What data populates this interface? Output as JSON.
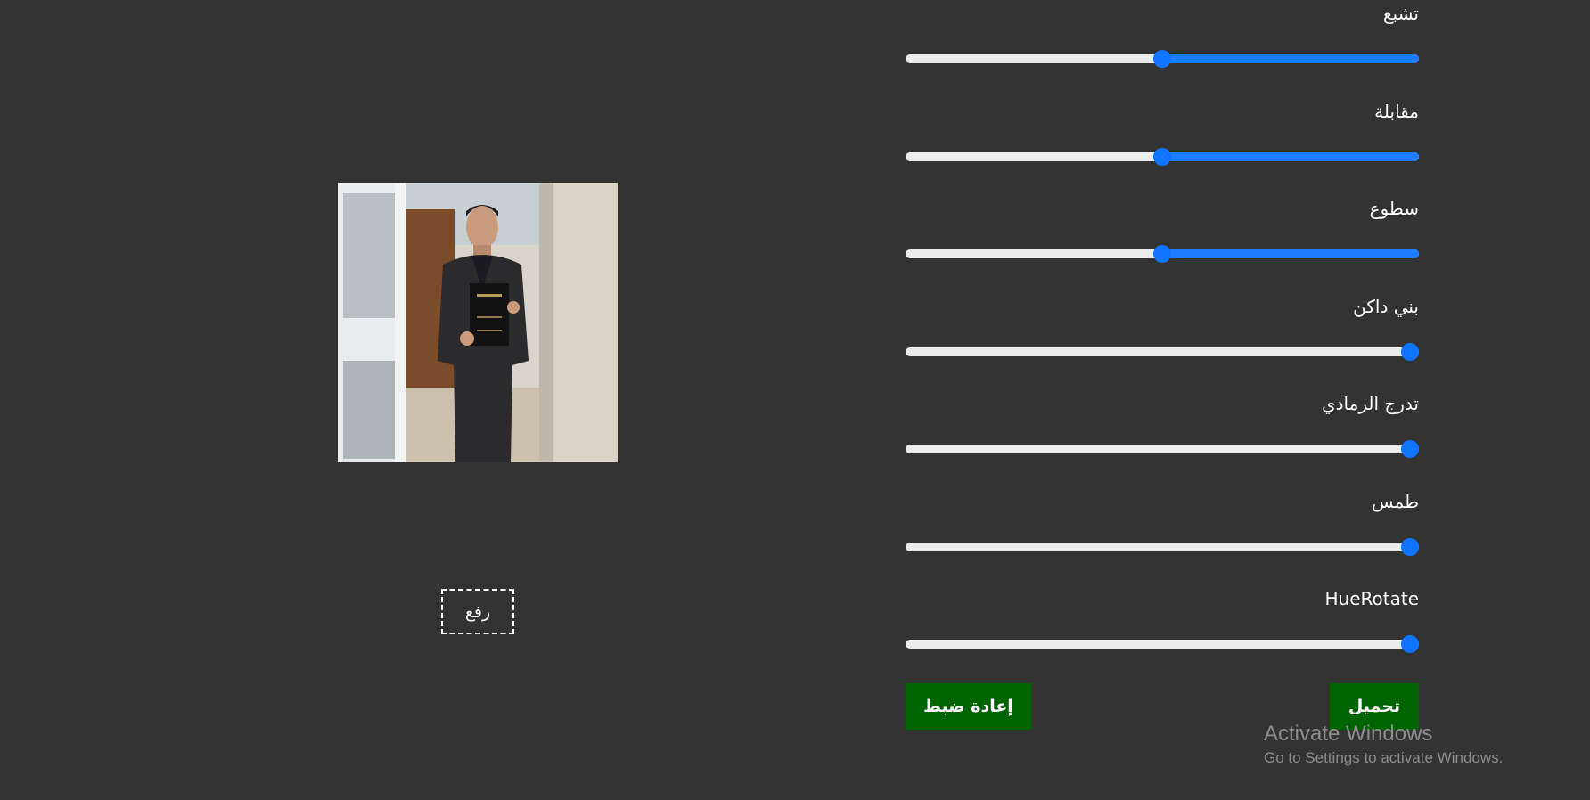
{
  "upload": {
    "label": "رفع"
  },
  "photo": {
    "alt": "photo-preview"
  },
  "sliders": [
    {
      "label": "تشبع",
      "value": 0.5
    },
    {
      "label": "مقابلة",
      "value": 0.5
    },
    {
      "label": "سطوع",
      "value": 0.5
    },
    {
      "label": "بني داكن",
      "value": 0.0
    },
    {
      "label": "تدرج الرمادي",
      "value": 0.0
    },
    {
      "label": "طمس",
      "value": 0.0
    },
    {
      "label": "HueRotate",
      "value": 0.0
    }
  ],
  "actions": {
    "download_label": "تحميل",
    "reset_label": "إعادة ضبط"
  },
  "watermark": {
    "title": "Activate Windows",
    "subtitle": "Go to Settings to activate Windows."
  },
  "colors": {
    "background": "#333333",
    "slider_fill": "#1a7cff",
    "slider_track": "#ececec",
    "button_green": "#006400"
  }
}
